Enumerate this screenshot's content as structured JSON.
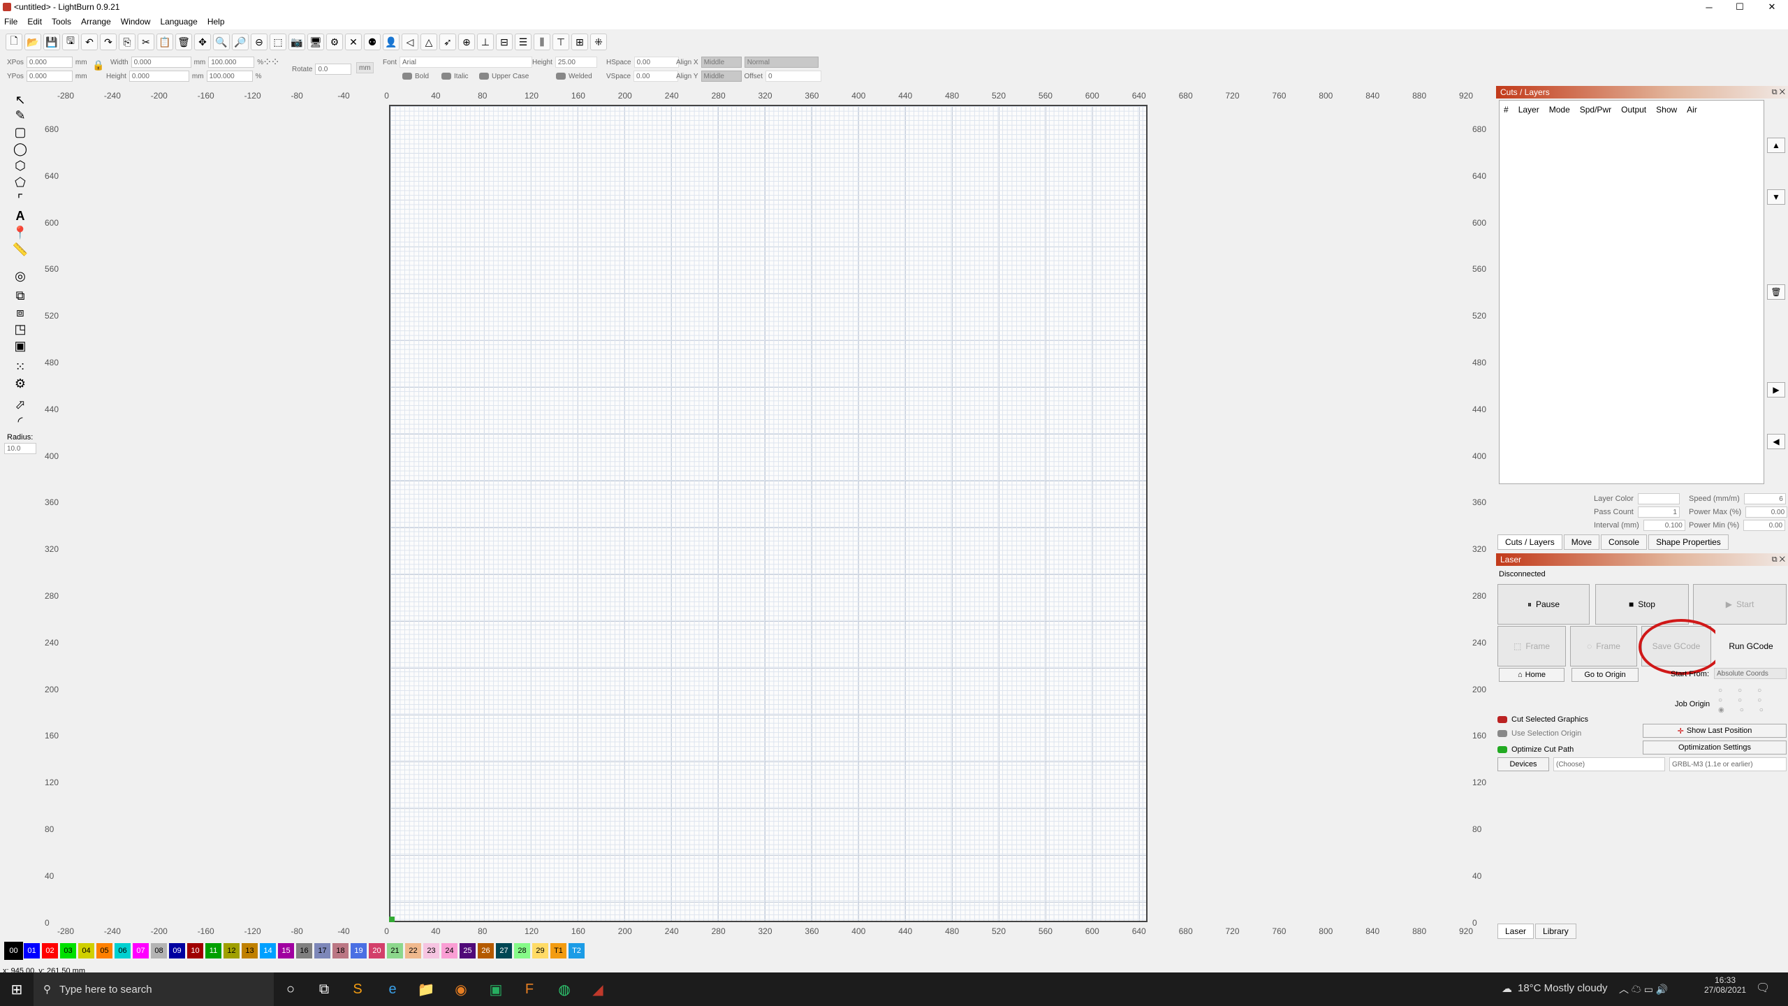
{
  "window": {
    "title": "<untitled> - LightBurn 0.9.21",
    "minimize": "─",
    "maximize": "☐",
    "close": "✕"
  },
  "menu": [
    "File",
    "Edit",
    "Tools",
    "Arrange",
    "Window",
    "Language",
    "Help"
  ],
  "props": {
    "xpos_label": "XPos",
    "xpos": "0.000",
    "ypos_label": "YPos",
    "ypos": "0.000",
    "mm1": "mm",
    "mm2": "mm",
    "width_label": "Width",
    "width": "0.000",
    "height_label": "Height",
    "height": "0.000",
    "wpct": "100.000",
    "hpct": "100.000",
    "pct": "%",
    "rotate_label": "Rotate",
    "rotate": "0.0",
    "unit_btn": "mm",
    "font_label": "Font",
    "font": "Arial",
    "fheight_label": "Height",
    "fheight": "25.00",
    "hspace_label": "HSpace",
    "hspace": "0.00",
    "vspace_label": "VSpace",
    "vspace": "0.00",
    "alignx_label": "Align X",
    "alignx": "Middle",
    "aligny_label": "Align Y",
    "aligny": "Middle",
    "normal": "Normal",
    "offset_label": "Offset",
    "offset": "0",
    "bold": "Bold",
    "italic": "Italic",
    "upper": "Upper Case",
    "welded": "Welded"
  },
  "tools": {
    "radius_label": "Radius:",
    "radius": "10.0"
  },
  "ruler_x": [
    "-280",
    "-240",
    "-200",
    "-160",
    "-120",
    "-80",
    "-40",
    "0",
    "40",
    "80",
    "120",
    "160",
    "200",
    "240",
    "280",
    "320",
    "360",
    "400",
    "440",
    "480",
    "520",
    "560",
    "600",
    "640",
    "680",
    "720",
    "760",
    "800",
    "840",
    "880",
    "920"
  ],
  "ruler_y": [
    "680",
    "640",
    "600",
    "560",
    "520",
    "480",
    "440",
    "400",
    "360",
    "320",
    "280",
    "240",
    "200",
    "160",
    "120",
    "80",
    "40",
    "0"
  ],
  "palette": [
    {
      "l": "00",
      "c": "#000000",
      "t": "#fff"
    },
    {
      "l": "01",
      "c": "#0000ff",
      "t": "#fff"
    },
    {
      "l": "02",
      "c": "#ff0000",
      "t": "#fff"
    },
    {
      "l": "03",
      "c": "#00e000",
      "t": "#000"
    },
    {
      "l": "04",
      "c": "#d0d000",
      "t": "#000"
    },
    {
      "l": "05",
      "c": "#ff8000",
      "t": "#000"
    },
    {
      "l": "06",
      "c": "#00d0d0",
      "t": "#000"
    },
    {
      "l": "07",
      "c": "#ff00ff",
      "t": "#fff"
    },
    {
      "l": "08",
      "c": "#b4b4b4",
      "t": "#000"
    },
    {
      "l": "09",
      "c": "#0000a0",
      "t": "#fff"
    },
    {
      "l": "10",
      "c": "#a00000",
      "t": "#fff"
    },
    {
      "l": "11",
      "c": "#00a000",
      "t": "#fff"
    },
    {
      "l": "12",
      "c": "#a0a000",
      "t": "#000"
    },
    {
      "l": "13",
      "c": "#c08000",
      "t": "#000"
    },
    {
      "l": "14",
      "c": "#00a0ff",
      "t": "#fff"
    },
    {
      "l": "15",
      "c": "#a000a0",
      "t": "#fff"
    },
    {
      "l": "16",
      "c": "#808080",
      "t": "#000"
    },
    {
      "l": "17",
      "c": "#7d87b9",
      "t": "#000"
    },
    {
      "l": "18",
      "c": "#bb7784",
      "t": "#000"
    },
    {
      "l": "19",
      "c": "#4a6fe3",
      "t": "#fff"
    },
    {
      "l": "20",
      "c": "#d33f6a",
      "t": "#fff"
    },
    {
      "l": "21",
      "c": "#8cd78c",
      "t": "#000"
    },
    {
      "l": "22",
      "c": "#f0b98d",
      "t": "#000"
    },
    {
      "l": "23",
      "c": "#f6c4e1",
      "t": "#000"
    },
    {
      "l": "24",
      "c": "#fa9ed4",
      "t": "#000"
    },
    {
      "l": "25",
      "c": "#500a78",
      "t": "#fff"
    },
    {
      "l": "26",
      "c": "#b45a00",
      "t": "#fff"
    },
    {
      "l": "27",
      "c": "#004754",
      "t": "#fff"
    },
    {
      "l": "28",
      "c": "#86fa88",
      "t": "#000"
    },
    {
      "l": "29",
      "c": "#ffdb66",
      "t": "#000"
    },
    {
      "l": "T1",
      "c": "#f39c12",
      "t": "#000"
    },
    {
      "l": "T2",
      "c": "#1c9ce6",
      "t": "#fff"
    }
  ],
  "status": "x: 945.00, y: 261.50 mm",
  "layers": {
    "title": "Cuts / Layers",
    "columns": [
      "#",
      "Layer",
      "Mode",
      "Spd/Pwr",
      "Output",
      "Show",
      "Air"
    ],
    "layer_color": "Layer Color",
    "speed": "Speed (mm/m)",
    "speed_v": "6",
    "pass_count": "Pass Count",
    "pass_v": "1",
    "power_max": "Power Max (%)",
    "pmax_v": "0.00",
    "interval": "Interval (mm)",
    "interval_v": "0.100",
    "power_min": "Power Min (%)",
    "pmin_v": "0.00",
    "tabs": [
      "Cuts / Layers",
      "Move",
      "Console",
      "Shape Properties"
    ]
  },
  "laser": {
    "title": "Laser",
    "state": "Disconnected",
    "pause": "Pause",
    "stop": "Stop",
    "start": "Start",
    "frame1": "Frame",
    "frame2": "Frame",
    "save": "Save GCode",
    "run": "Run GCode",
    "home": "Home",
    "goto": "Go to Origin",
    "start_from": "Start From:",
    "start_from_v": "Absolute Coords",
    "job_origin": "Job Origin",
    "cut_sel": "Cut Selected Graphics",
    "use_sel": "Use Selection Origin",
    "optimize": "Optimize Cut Path",
    "show_last": "Show Last Position",
    "opt_settings": "Optimization Settings",
    "devices": "Devices",
    "choose": "(Choose)",
    "grbl": "GRBL-M3 (1.1e or earlier)",
    "tabs": [
      "Laser",
      "Library"
    ]
  },
  "taskbar": {
    "search": "Type here to search",
    "weather": "18°C  Mostly cloudy",
    "time": "16:33",
    "date": "27/08/2021"
  }
}
